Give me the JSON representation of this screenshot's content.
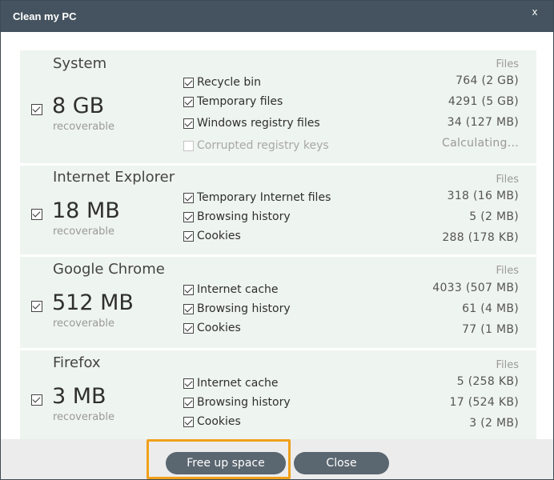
{
  "window": {
    "title": "Clean my PC",
    "close_glyph": "x"
  },
  "sections": [
    {
      "title": "System",
      "size": "8 GB",
      "recoverable": "recoverable",
      "files_header": "Files",
      "rows": [
        {
          "label": "Recycle bin",
          "value": "764 (2 GB)",
          "checked": true
        },
        {
          "label": "Temporary files",
          "value": "4291 (5 GB)",
          "checked": true
        },
        {
          "label": "Windows registry files",
          "value": "34 (127 MB)",
          "checked": true
        },
        {
          "label": "Corrupted registry keys",
          "value": "Calculating...",
          "checked": false
        }
      ]
    },
    {
      "title": "Internet Explorer",
      "size": "18 MB",
      "recoverable": "recoverable",
      "files_header": "Files",
      "rows": [
        {
          "label": "Temporary Internet files",
          "value": "318 (16 MB)",
          "checked": true
        },
        {
          "label": "Browsing history",
          "value": "5 (2 MB)",
          "checked": true
        },
        {
          "label": "Cookies",
          "value": "288 (178 KB)",
          "checked": true
        }
      ]
    },
    {
      "title": "Google Chrome",
      "size": "512 MB",
      "recoverable": "recoverable",
      "files_header": "Files",
      "rows": [
        {
          "label": "Internet cache",
          "value": "4033 (507 MB)",
          "checked": true
        },
        {
          "label": "Browsing history",
          "value": "61 (4 MB)",
          "checked": true
        },
        {
          "label": "Cookies",
          "value": "77 (1 MB)",
          "checked": true
        }
      ]
    },
    {
      "title": "Firefox",
      "size": "3 MB",
      "recoverable": "recoverable",
      "files_header": "Files",
      "rows": [
        {
          "label": "Internet cache",
          "value": "5 (258 KB)",
          "checked": true
        },
        {
          "label": "Browsing history",
          "value": "17 (524 KB)",
          "checked": true
        },
        {
          "label": "Cookies",
          "value": "3 (2 MB)",
          "checked": true
        }
      ]
    }
  ],
  "footer": {
    "free_up_label": "Free up space",
    "close_label": "Close"
  },
  "colors": {
    "titlebar": "#44535f",
    "section_bg": "#eef4ef",
    "button_bg": "#5a6670",
    "highlight": "#f0a019"
  }
}
